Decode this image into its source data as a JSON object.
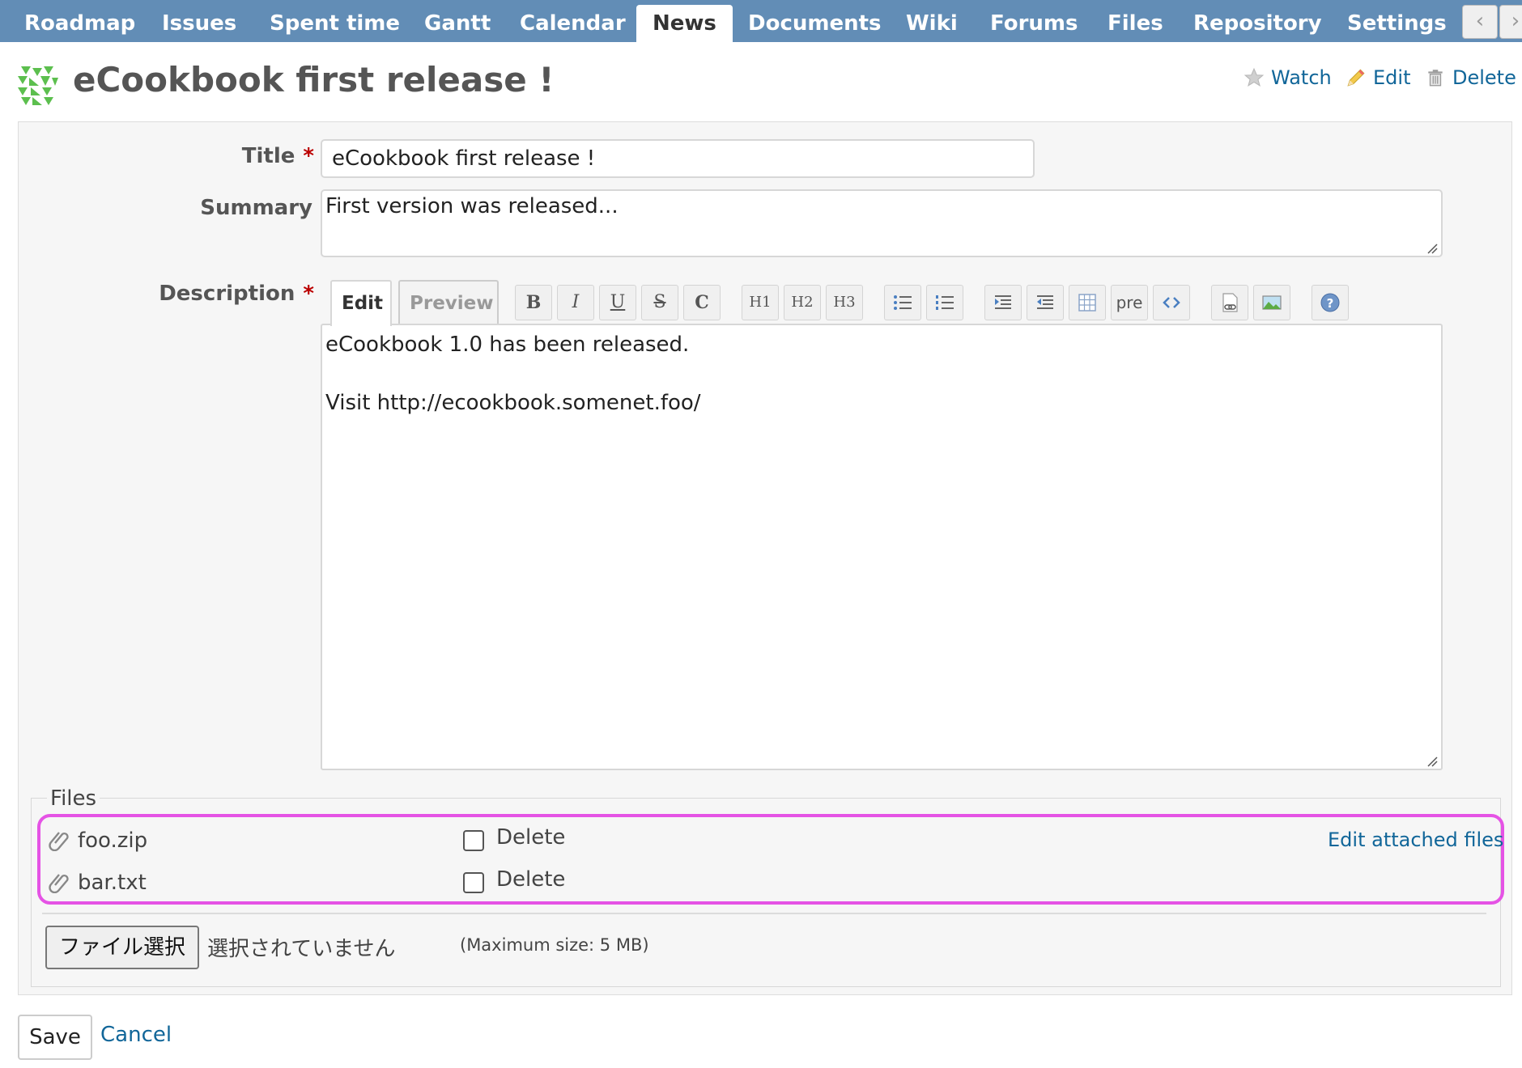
{
  "nav": {
    "tabs": [
      "Roadmap",
      "Issues",
      "Spent time",
      "Gantt",
      "Calendar",
      "News",
      "Documents",
      "Wiki",
      "Forums",
      "Files",
      "Repository",
      "Settings"
    ],
    "active_tab": "News",
    "scroll_left": "‹",
    "scroll_right": "›"
  },
  "header": {
    "title": "eCookbook first release !",
    "actions": {
      "watch": "Watch",
      "edit": "Edit",
      "delete": "Delete"
    }
  },
  "form": {
    "title_label": "Title",
    "title_value": "eCookbook first release !",
    "summary_label": "Summary",
    "summary_value": "First version was released...",
    "description_label": "Description",
    "required_mark": "*",
    "editor_tabs": {
      "edit": "Edit",
      "preview": "Preview"
    },
    "toolbar": {
      "bold": "B",
      "italic": "I",
      "underline": "U",
      "strike": "S",
      "code": "C",
      "h1": "H1",
      "h2": "H2",
      "h3": "H3",
      "pre": "pre"
    },
    "description_value": "eCookbook 1.0 has been released.\n\nVisit http://ecookbook.somenet.foo/"
  },
  "files": {
    "legend": "Files",
    "attachments": [
      {
        "name": "foo.zip",
        "delete_label": "Delete",
        "checked": false
      },
      {
        "name": "bar.txt",
        "delete_label": "Delete",
        "checked": false
      }
    ],
    "edit_link": "Edit attached files",
    "choose_button": "ファイル選択",
    "no_file_text": "選択されていません",
    "max_size": "(Maximum size: 5 MB)"
  },
  "buttons": {
    "save": "Save",
    "cancel": "Cancel"
  },
  "colors": {
    "topbar": "#628db6",
    "link": "#1166aa",
    "highlight": "#e553e5",
    "required": "#bb0000"
  }
}
